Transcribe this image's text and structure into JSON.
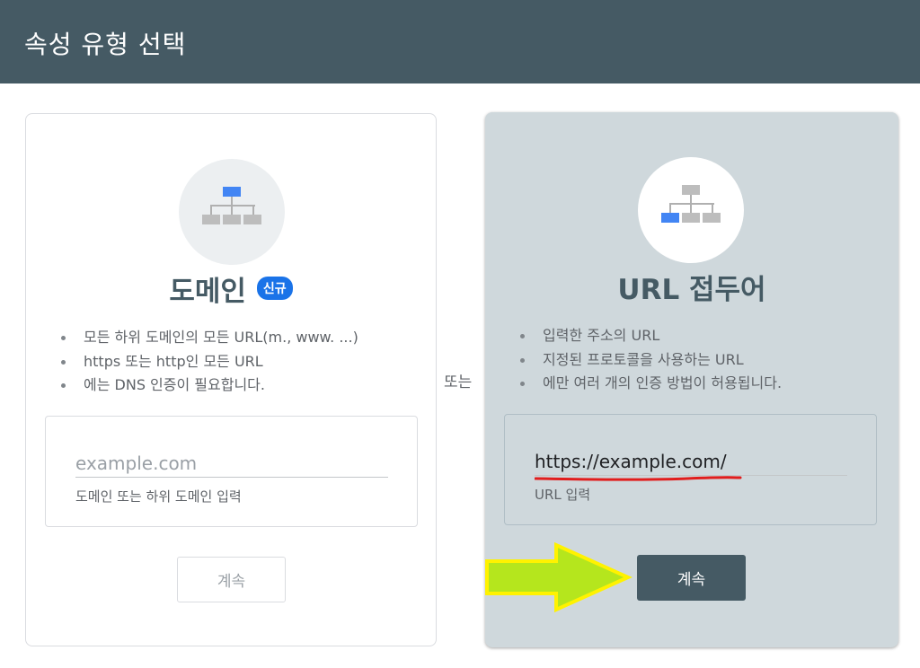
{
  "header": {
    "title": "속성 유형 선택"
  },
  "domain_card": {
    "icon": "sitemap-top-highlight-icon",
    "title": "도메인",
    "badge": "신규",
    "features": [
      "모든 하위 도메인의 모든 URL(m., www. ...)",
      "https 또는 http인 모든 URL",
      "에는 DNS 인증이 필요합니다."
    ],
    "input": {
      "value": "",
      "placeholder": "example.com",
      "helper": "도메인 또는 하위 도메인 입력"
    },
    "continue_label": "계속"
  },
  "separator": {
    "label": "또는"
  },
  "url_card": {
    "icon": "sitemap-bottom-left-highlight-icon",
    "title": "URL 접두어",
    "features": [
      "입력한 주소의 URL",
      "지정된 프로토콜을 사용하는 URL",
      "에만 여러 개의 인증 방법이 허용됩니다."
    ],
    "input": {
      "value": "https://example.com/",
      "placeholder": "",
      "helper": "URL 입력"
    },
    "continue_label": "계속"
  },
  "colors": {
    "header": "#455a64",
    "accent_blue": "#1a73e8",
    "selected_card": "#cfd8dc",
    "annotation_arrow": "#b5e61d",
    "annotation_arrow_border": "#fff200",
    "annotation_underline": "#e11d1d"
  }
}
